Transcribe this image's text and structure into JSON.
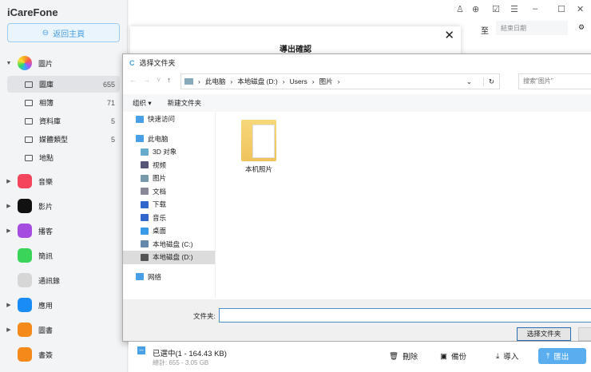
{
  "app": {
    "title": "iCareFone",
    "home": "返回主頁"
  },
  "sidebar": {
    "photos": "圖片",
    "sub": [
      {
        "label": "圖庫",
        "count": "655"
      },
      {
        "label": "相簿",
        "count": "71"
      },
      {
        "label": "資料庫",
        "count": "5"
      },
      {
        "label": "媒體類型",
        "count": "5"
      },
      {
        "label": "地點",
        "count": ""
      }
    ],
    "apps": [
      {
        "label": "音樂",
        "color": "#f5455c"
      },
      {
        "label": "影片",
        "color": "#111111"
      },
      {
        "label": "播客",
        "color": "#a54de0"
      },
      {
        "label": "簡訊",
        "color": "#3bd45a"
      },
      {
        "label": "通訊錄",
        "color": "#d6d6d6"
      },
      {
        "label": "應用",
        "color": "#1a8cf5"
      },
      {
        "label": "圖書",
        "color": "#f58a1a"
      },
      {
        "label": "書簽",
        "color": "#f58a1a"
      }
    ]
  },
  "header": {
    "to": "至",
    "end_date": "結束日期"
  },
  "modal": {
    "title": "導出確認"
  },
  "dialog": {
    "title": "选择文件夹",
    "path": [
      "此电脑",
      "本地磁盘 (D:)",
      "Users",
      "图片"
    ],
    "search": "搜索\"图片\"",
    "organize": "组织 ▾",
    "new_folder": "新建文件夹",
    "tree": [
      "快速访问",
      "此电脑",
      "3D 对象",
      "视频",
      "图片",
      "文档",
      "下载",
      "音乐",
      "桌面",
      "本地磁盘 (C:)",
      "本地磁盘 (D:)",
      "网络"
    ],
    "folder": "本机照片",
    "folder_label": "文件夹:",
    "select": "选择文件夹"
  },
  "footer": {
    "selected": "已選中(1 - 164.43 KB)",
    "total": "總計: 655 - 3.05 GB",
    "delete": "刪除",
    "backup": "備份",
    "import": "導入",
    "export": "匯出"
  }
}
